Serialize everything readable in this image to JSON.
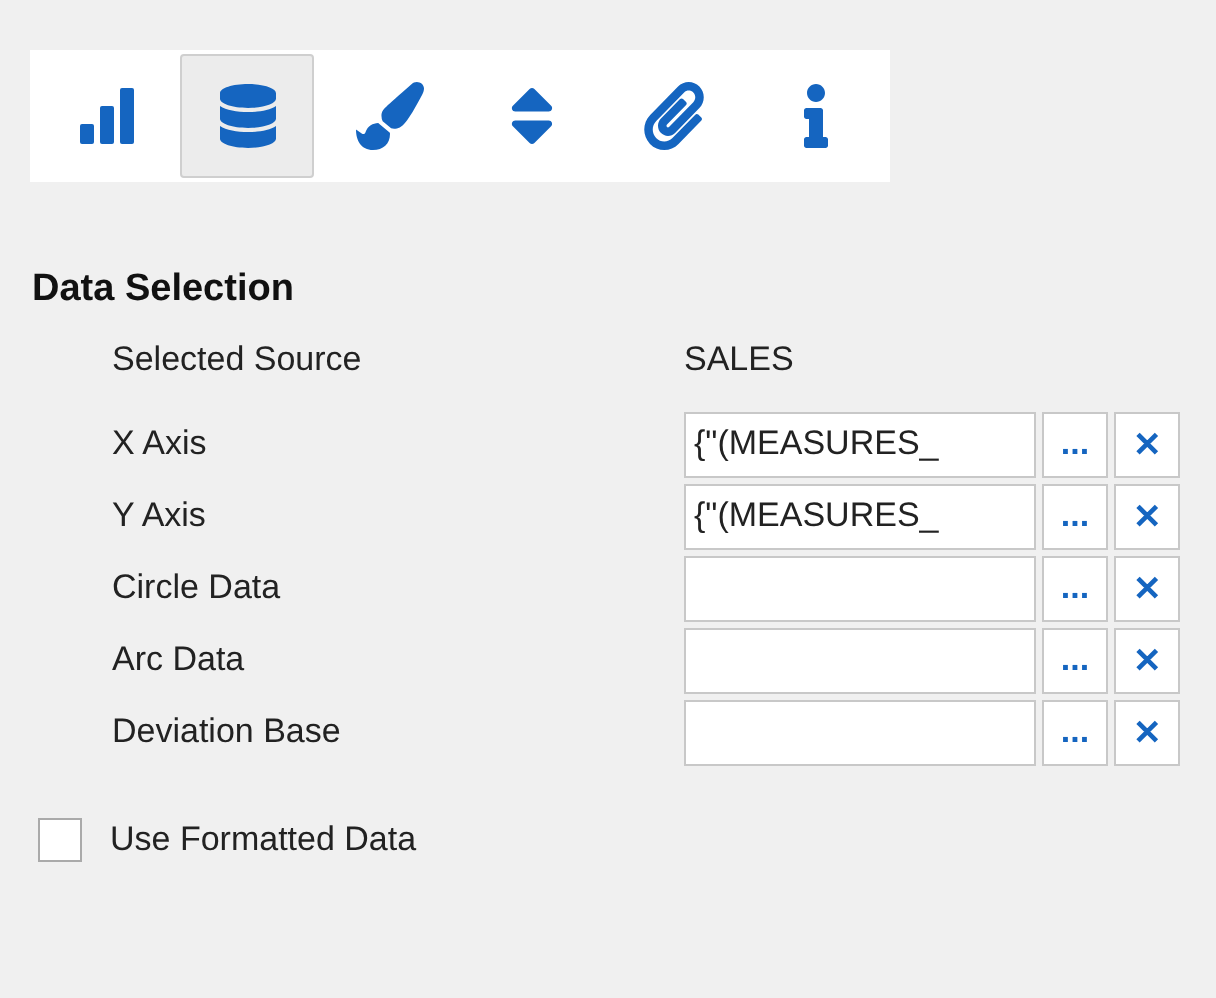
{
  "toolbar": [
    {
      "kind": "bars",
      "selected": false
    },
    {
      "kind": "database",
      "selected": true
    },
    {
      "kind": "brush",
      "selected": false
    },
    {
      "kind": "sort",
      "selected": false
    },
    {
      "kind": "paperclip",
      "selected": false
    },
    {
      "kind": "info",
      "selected": false
    }
  ],
  "section": {
    "title": "Data Selection",
    "source": {
      "label": "Selected Source",
      "value": "SALES"
    },
    "fields": [
      {
        "label": "X Axis",
        "value": "{\"(MEASURES_",
        "browse": "...",
        "clear": "✕"
      },
      {
        "label": "Y Axis",
        "value": "{\"(MEASURES_",
        "browse": "...",
        "clear": "✕"
      },
      {
        "label": "Circle Data",
        "browse": "...",
        "clear": "✕"
      },
      {
        "label": "Arc Data",
        "browse": "...",
        "clear": "✕"
      },
      {
        "label": "Deviation Base",
        "browse": "...",
        "clear": "✕"
      }
    ]
  },
  "formatted": {
    "label": "Use Formatted Data",
    "checked": false
  }
}
